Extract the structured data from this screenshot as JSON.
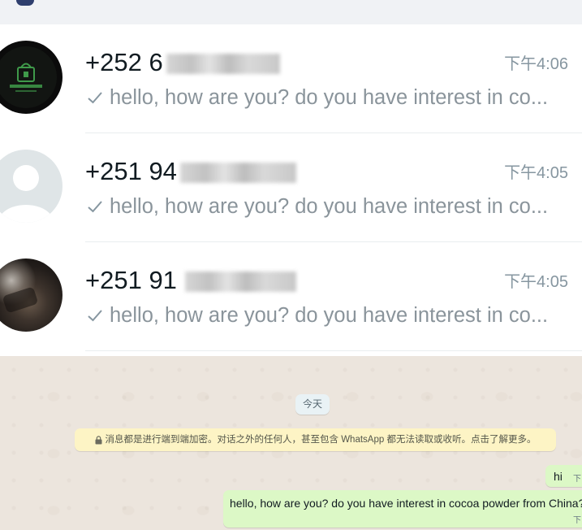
{
  "header": {
    "search_icon": "search-icon"
  },
  "chat_list": {
    "items": [
      {
        "avatar_icon": "store-logo-avatar",
        "name": "+252 6",
        "time": "下午4:06",
        "status_icon": "single-check-icon",
        "preview": "hello, how are you? do you have interest in co..."
      },
      {
        "avatar_icon": "default-user-avatar",
        "name": "+251 94",
        "time": "下午4:05",
        "status_icon": "single-check-icon",
        "preview": "hello, how are you? do you have interest in co..."
      },
      {
        "avatar_icon": "contact-photo-avatar",
        "name": "+251 91",
        "time": "下午4:05",
        "status_icon": "single-check-icon",
        "preview": "hello, how are you? do you have interest in co..."
      }
    ]
  },
  "conversation": {
    "date_label": "今天",
    "encryption_notice": {
      "icon": "lock-icon",
      "text": "消息都是进行端到端加密。对话之外的任何人，甚至包含 WhatsApp 都无法读取或收听。点击了解更多。"
    },
    "messages": [
      {
        "text": "hi",
        "time": "下"
      },
      {
        "text": "hello, how are you? do you have interest in cocoa powder from China?",
        "time": "下"
      }
    ]
  },
  "colors": {
    "outgoing_bubble": "#dcf8c6",
    "notice_background": "#fdf4c5",
    "chat_background": "#ece5dd",
    "date_chip": "#e9f2f5"
  }
}
